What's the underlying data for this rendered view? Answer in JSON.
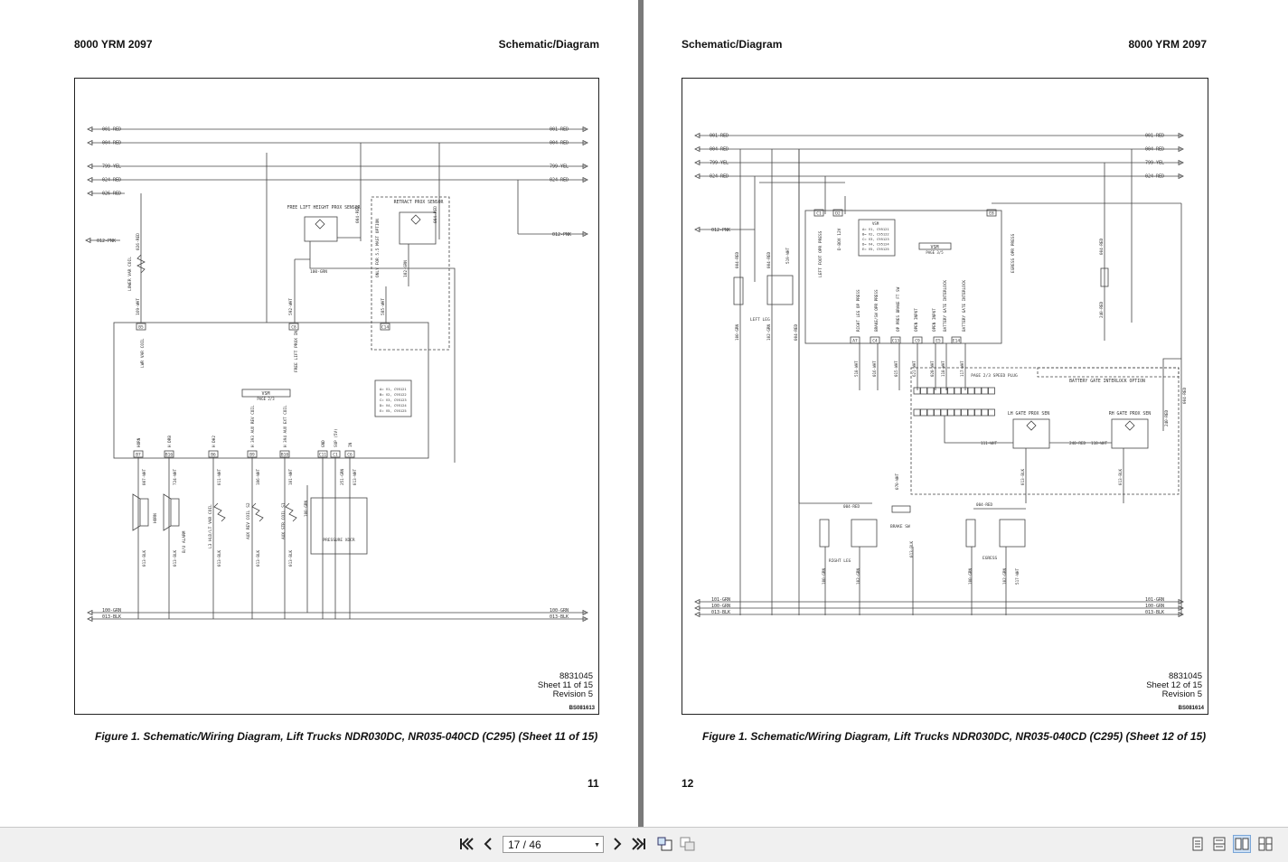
{
  "viewer": {
    "page_indicator": "17 / 46",
    "toolbar": {
      "first_page_icon": "first-page-icon",
      "prev_page_icon": "prev-page-icon",
      "next_page_icon": "next-page-icon",
      "last_page_icon": "last-page-icon",
      "rotate_icon": "rotate-icon",
      "fit_icon": "fit-icon",
      "view_modes": [
        "single-page-icon",
        "continuous-icon",
        "two-page-icon",
        "two-page-continuous-icon"
      ]
    }
  },
  "pages": [
    {
      "header_left": "8000 YRM 2097",
      "header_right": "Schematic/Diagram",
      "sheet_code": "8831045",
      "sheet": "Sheet 11 of 15",
      "revision": "Revision 5",
      "drawing_id": "BS081613",
      "caption": "Figure 1. Schematic/Wiring Diagram, Lift Trucks NDR030DC, NR035-040CD (C295) (Sheet 11 of 15)",
      "page_number": "11",
      "wires_top": [
        {
          "left": "001-RED",
          "right": "001-RED"
        },
        {
          "left": "004-RED",
          "right": "004-RED"
        },
        {
          "left": "799-YEL",
          "right": "799-YEL"
        },
        {
          "left": "024-RED",
          "right": "024-RED"
        },
        {
          "left": "026-RED",
          "right": ""
        }
      ],
      "wire_pnk": {
        "left": "012-PNK",
        "right": "012-PNK"
      },
      "wires_bottom": [
        {
          "left": "100-GRN",
          "right": "100-GRN"
        },
        {
          "left": "013-BLK",
          "right": "013-BLK"
        }
      ],
      "labels": {
        "free_lift": "FREE LIFT HEIGHT PROX SENSOR",
        "retract": "RETRACT PROX SENSOR",
        "mast_option": "ONLY FOR 5.5 MAST OPTION",
        "vsm": "VSM",
        "vsm_page": "PAGE 2/3",
        "vsm_table": [
          "A= V1, C95121",
          "B= V2, C95122",
          "C= V3, C95123",
          "D= V4, C95124",
          "E= V5, C95125"
        ],
        "pressure": "PRESSURE XDCR",
        "lower_var_coil": "LOWER VAR COIL",
        "lwr_var_coil": "LWR VAR COIL",
        "free_lift_prox": "FREE LIFT PROX IN",
        "connectors_top": [
          "B5",
          "C8",
          "C14"
        ],
        "connectors_bottom": [
          "B7",
          "B16",
          "B6",
          "B9",
          "B10",
          "C11",
          "C1",
          "C6"
        ],
        "pins_bottom": [
          "HORN",
          "H DRB",
          "H DH2",
          "H 393 AUX REV COIL",
          "H 394 AUX EXT COIL",
          "GND",
          "SUP (5V)",
          "IN"
        ],
        "devices": [
          "HORN",
          "B/U ALARM",
          "L3 HLD/LT VAR COIL",
          "AUX REV COIL S2",
          "AUX STR COIL S1"
        ],
        "wire_ids": [
          "026-RED",
          "169-WHT",
          "592-WHT",
          "585-WHT",
          "004-RED",
          "004-RED",
          "100-GRN",
          "102-GRN",
          "007-WHT",
          "724-WHT",
          "011-WHT",
          "106-WHT",
          "101-WHT",
          "251-GRN",
          "013-WHT",
          "100-GRN",
          "013-BLK",
          "013-BLK",
          "013-BLK",
          "013-BLK",
          "013-BLK"
        ]
      }
    },
    {
      "header_left": "Schematic/Diagram",
      "header_right": "8000 YRM 2097",
      "sheet_code": "8831045",
      "sheet": "Sheet 12 of 15",
      "revision": "Revision 5",
      "drawing_id": "BS081614",
      "caption": "Figure 1. Schematic/Wiring Diagram, Lift Trucks NDR030DC, NR035-040CD (C295) (Sheet 12 of 15)",
      "page_number": "12",
      "wires_top": [
        {
          "left": "001-RED",
          "right": "001-RED"
        },
        {
          "left": "004-RED",
          "right": "004-RED"
        },
        {
          "left": "799-YEL",
          "right": "799-YEL"
        },
        {
          "left": "024-RED",
          "right": "024-RED"
        }
      ],
      "wire_pnk": {
        "left": "012-PNK",
        "right": ""
      },
      "wires_bottom": [
        {
          "left": "101-GRN",
          "right": "101-GRN"
        },
        {
          "left": "100-GRN",
          "right": "100-GRN"
        },
        {
          "left": "013-BLK",
          "right": "013-BLK"
        }
      ],
      "labels": {
        "vsm": "VSM",
        "vsm_page": "PAGE 3/5",
        "vsm_table": [
          "A= V1, C95121",
          "B= V2, C95122",
          "C= V3, C95123",
          "D= V4, C95124",
          "E= V5, C95125"
        ],
        "spdd_plug": "PAGE 2/3 SPEED PLUG",
        "battery_gate": "BATTERY GATE INTERLOCK OPTION",
        "lh_gate": "LH GATE PROX SEN",
        "rh_gate": "RH GATE PROX SEN",
        "left_leg": "LEFT LEG",
        "right_leg": "RIGHT LEG",
        "egress": "EGRESS",
        "brake_sw": "BRAKE SW",
        "left_foot": "LEFT FOOT OPR PRESS",
        "dbox": "D-BOX 12V",
        "egress_opr": "EGRESS OPR PRESS",
        "pins": [
          "RIGHT LEG OP PRESS",
          "BRAKE/SW OPR PRESS",
          "OP PRES BRAKE FT SW",
          "OPEN INPUT",
          "OPEN INPUT",
          "BATTERY GATE INTERLOCK",
          "BATTERY GATE INTERLOCK"
        ],
        "connectors": [
          "C1",
          "D2",
          "E9",
          "E8",
          "A7",
          "C4",
          "C13",
          "C9",
          "E5",
          "E14"
        ],
        "wire_ids": [
          "004-RED",
          "004-RED",
          "519-WHT",
          "004-RED",
          "100-GRN",
          "102-GRN",
          "518-WHT",
          "016-WHT",
          "015-WHT",
          "621-WHT",
          "020-WHT",
          "118-WHT",
          "117-WHT",
          "111-WHT",
          "240-RED",
          "118-WHT",
          "013-BLK",
          "013-BLK",
          "240-RED",
          "004-RED",
          "004-RED",
          "004-RED",
          "100-GRN",
          "102-GRN",
          "517-WHT",
          "013-BLK",
          "070-WHT",
          "100-GRN"
        ]
      }
    }
  ]
}
